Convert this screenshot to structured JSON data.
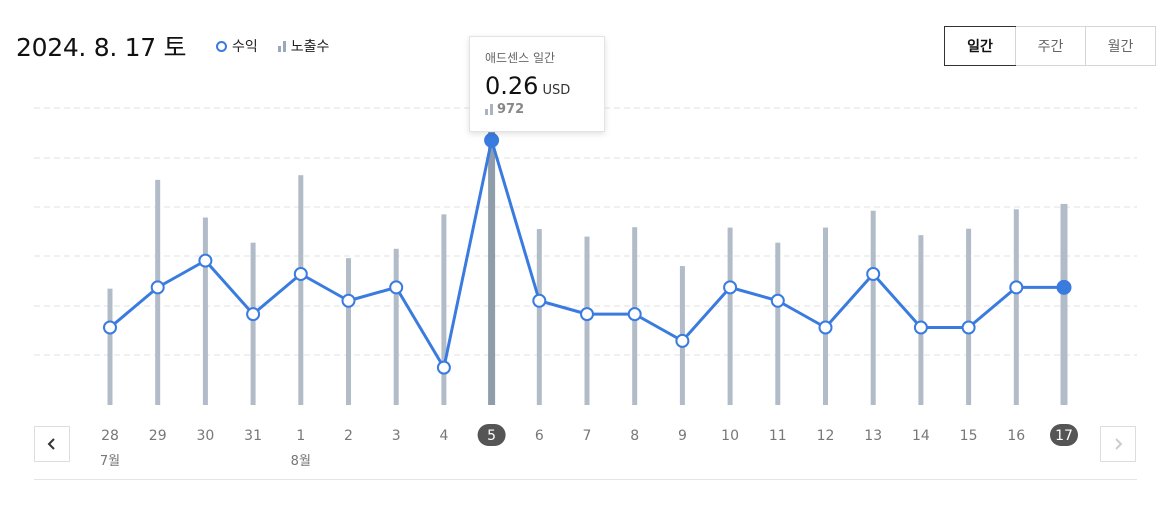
{
  "header": {
    "date": "2024. 8. 17 토",
    "legend": {
      "revenue": "수익",
      "impressions": "노출수"
    }
  },
  "period": {
    "options": [
      "일간",
      "주간",
      "월간"
    ],
    "selected": "일간"
  },
  "tooltip": {
    "title": "애드센스 일간",
    "value": "0.26",
    "unit": "USD",
    "impressions": "972"
  },
  "nav": {
    "prev": "‹",
    "next": "›"
  },
  "colors": {
    "line": "#3a7be0",
    "bar": "#b1bcc8",
    "bar_highlight": "#8f9caa",
    "selected_badge": "#555555"
  },
  "chart_data": {
    "type": "line",
    "categories": [
      "28",
      "29",
      "30",
      "31",
      "1",
      "2",
      "3",
      "4",
      "5",
      "6",
      "7",
      "8",
      "9",
      "10",
      "11",
      "12",
      "13",
      "14",
      "15",
      "16",
      "17"
    ],
    "month_labels": [
      {
        "index": 0,
        "label": "7월"
      },
      {
        "index": 4,
        "label": "8월"
      }
    ],
    "highlighted_indices": [
      8,
      20
    ],
    "series": [
      {
        "name": "수익",
        "type": "line",
        "unit": "USD",
        "values": [
          0.12,
          0.15,
          0.17,
          0.13,
          0.16,
          0.14,
          0.15,
          0.09,
          0.26,
          0.14,
          0.13,
          0.13,
          0.11,
          0.15,
          0.14,
          0.12,
          0.16,
          0.12,
          0.12,
          0.15,
          0.15
        ]
      },
      {
        "name": "노출수",
        "type": "bar",
        "values": [
          324,
          627,
          522,
          452,
          640,
          409,
          435,
          531,
          972,
          490,
          469,
          495,
          387,
          494,
          452,
          494,
          541,
          473,
          491,
          545,
          560
        ]
      }
    ],
    "revenue_ylim": [
      0,
      0.32
    ],
    "impressions_ylim": [
      0,
      1100
    ],
    "grid": true
  }
}
